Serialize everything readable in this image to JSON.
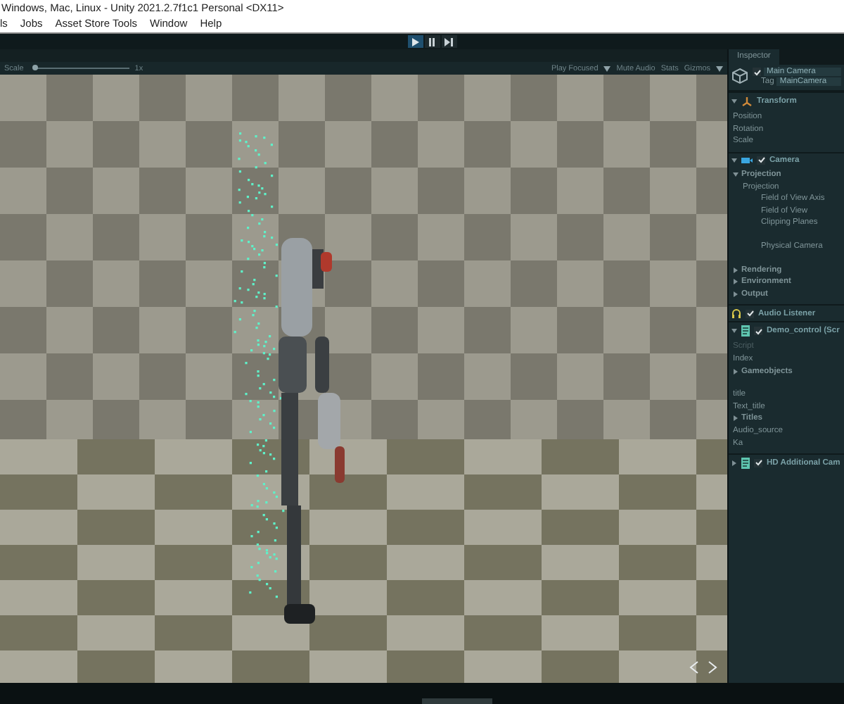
{
  "window": {
    "title": "Windows, Mac, Linux - Unity 2021.2.7f1c1 Personal <DX11>"
  },
  "menu": [
    "ls",
    "Jobs",
    "Asset Store Tools",
    "Window",
    "Help"
  ],
  "play_controls": [
    {
      "kind": "play",
      "selected": true
    },
    {
      "kind": "pause",
      "selected": false
    },
    {
      "kind": "step",
      "selected": false
    }
  ],
  "game_toolbar": {
    "scale_label": "Scale",
    "scale": {
      "level": 0.02
    },
    "scale_value": "1x",
    "options": [
      {
        "label": "Play Focused",
        "kind": "text"
      },
      {
        "kind": "caret"
      },
      {
        "label": "Mute Audio",
        "kind": "text"
      },
      {
        "label": "Stats",
        "kind": "text"
      },
      {
        "label": "Gizmos",
        "kind": "text"
      },
      {
        "kind": "caret"
      }
    ]
  },
  "inspector": {
    "tab": "Inspector",
    "object": {
      "name": "Main Camera",
      "enabled": true,
      "tag_label": "Tag",
      "tag": "MainCamera"
    },
    "components": [
      {
        "name": "Transform",
        "kind": "transform",
        "expanded": true,
        "rows": [
          {
            "label": "Position"
          },
          {
            "label": "Rotation"
          },
          {
            "label": "Scale"
          }
        ]
      },
      {
        "name": "Camera",
        "kind": "camera",
        "enabled": true,
        "expanded": true,
        "rows": [
          {
            "label": "Projection",
            "kind": "foldout",
            "expanded": true,
            "children": [
              {
                "label": "Projection",
                "children": [
                  {
                    "label": "Field of View Axis"
                  },
                  {
                    "label": "Field of View"
                  },
                  {
                    "label": "Clipping Planes"
                  },
                  {
                    "label": "Physical Camera",
                    "gap": true
                  }
                ]
              }
            ]
          },
          {
            "label": "Rendering",
            "kind": "foldout",
            "expanded": false,
            "gap": true
          },
          {
            "label": "Environment",
            "kind": "foldout",
            "expanded": false
          },
          {
            "label": "Output",
            "kind": "foldout",
            "expanded": false
          }
        ]
      },
      {
        "name": "Audio Listener",
        "kind": "audio",
        "enabled": true
      },
      {
        "name": "Demo_control (Scr",
        "kind": "script",
        "enabled": true,
        "expanded": true,
        "rows": [
          {
            "label": "Script",
            "disabled": true
          },
          {
            "label": "Index"
          },
          {
            "label": "Gameobjects",
            "kind": "foldout",
            "expanded": false
          },
          {
            "label": "title",
            "gap": true
          },
          {
            "label": "Text_title"
          },
          {
            "label": "Titles",
            "kind": "foldout",
            "expanded": false
          },
          {
            "label": "Audio_source"
          },
          {
            "label": "Ka"
          }
        ]
      },
      {
        "name": "HD Additional Cam",
        "kind": "script",
        "enabled": true,
        "expanded": false
      }
    ]
  }
}
